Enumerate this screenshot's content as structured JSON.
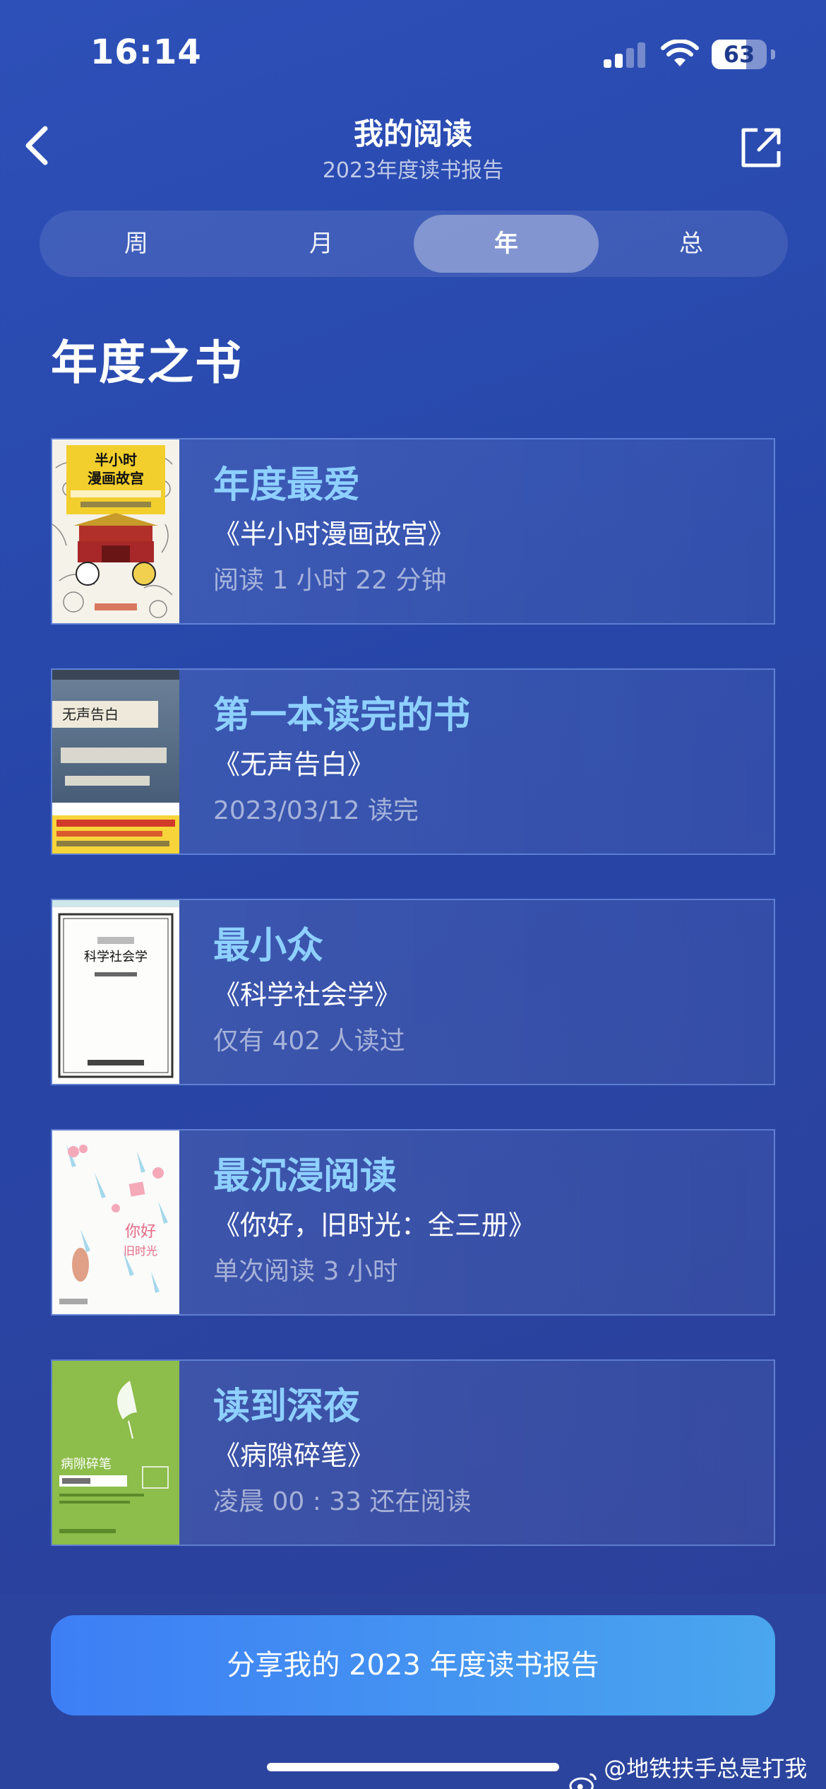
{
  "status_bar": {
    "time": "16:14",
    "battery": "63",
    "signal_bars": 2
  },
  "nav": {
    "title": "我的阅读",
    "subtitle": "2023年度读书报告"
  },
  "tabs": [
    {
      "label": "周",
      "active": false
    },
    {
      "label": "月",
      "active": false
    },
    {
      "label": "年",
      "active": true
    },
    {
      "label": "总",
      "active": false
    }
  ],
  "section_title": "年度之书",
  "cards": [
    {
      "label": "年度最爱",
      "book": "《半小时漫画故宫》",
      "detail": "阅读 1 小时 22 分钟",
      "cover": {
        "title": "半小时\n漫画故宫",
        "author": "陈磊·半小时漫画团队 著",
        "color": "#f3cf2e"
      }
    },
    {
      "label": "第一本读完的书",
      "book": "《无声告白》",
      "detail": "2023/03/12 读完",
      "cover": {
        "title": "无声告白",
        "top_text": "Celeste Ng / Everything I Never Told You",
        "color": "#4a5f7a"
      }
    },
    {
      "label": "最小众",
      "book": "《科学社会学》",
      "detail": "仅有 402 人读过",
      "cover": {
        "title": "科学社会学",
        "color": "#ffffff"
      }
    },
    {
      "label": "最沉浸阅读",
      "book": "《你好，旧时光：全三册》",
      "detail": "单次阅读 3 小时",
      "cover": {
        "title": "你好，旧时光",
        "author": "八月长安",
        "color": "#ffffff"
      }
    },
    {
      "label": "读到深夜",
      "book": "《病隙碎笔》",
      "detail": "凌晨 00 : 33 还在阅读",
      "cover": {
        "title": "病隙碎笔",
        "author": "史铁生 著",
        "color": "#8dbd4a"
      }
    }
  ],
  "share_button": "分享我的 2023 年度读书报告",
  "watermark": "@地铁扶手总是打我头",
  "colors": {
    "accent_label": "#8ed0ff",
    "button_start": "#3d7ef5",
    "button_end": "#4aa6ee"
  }
}
